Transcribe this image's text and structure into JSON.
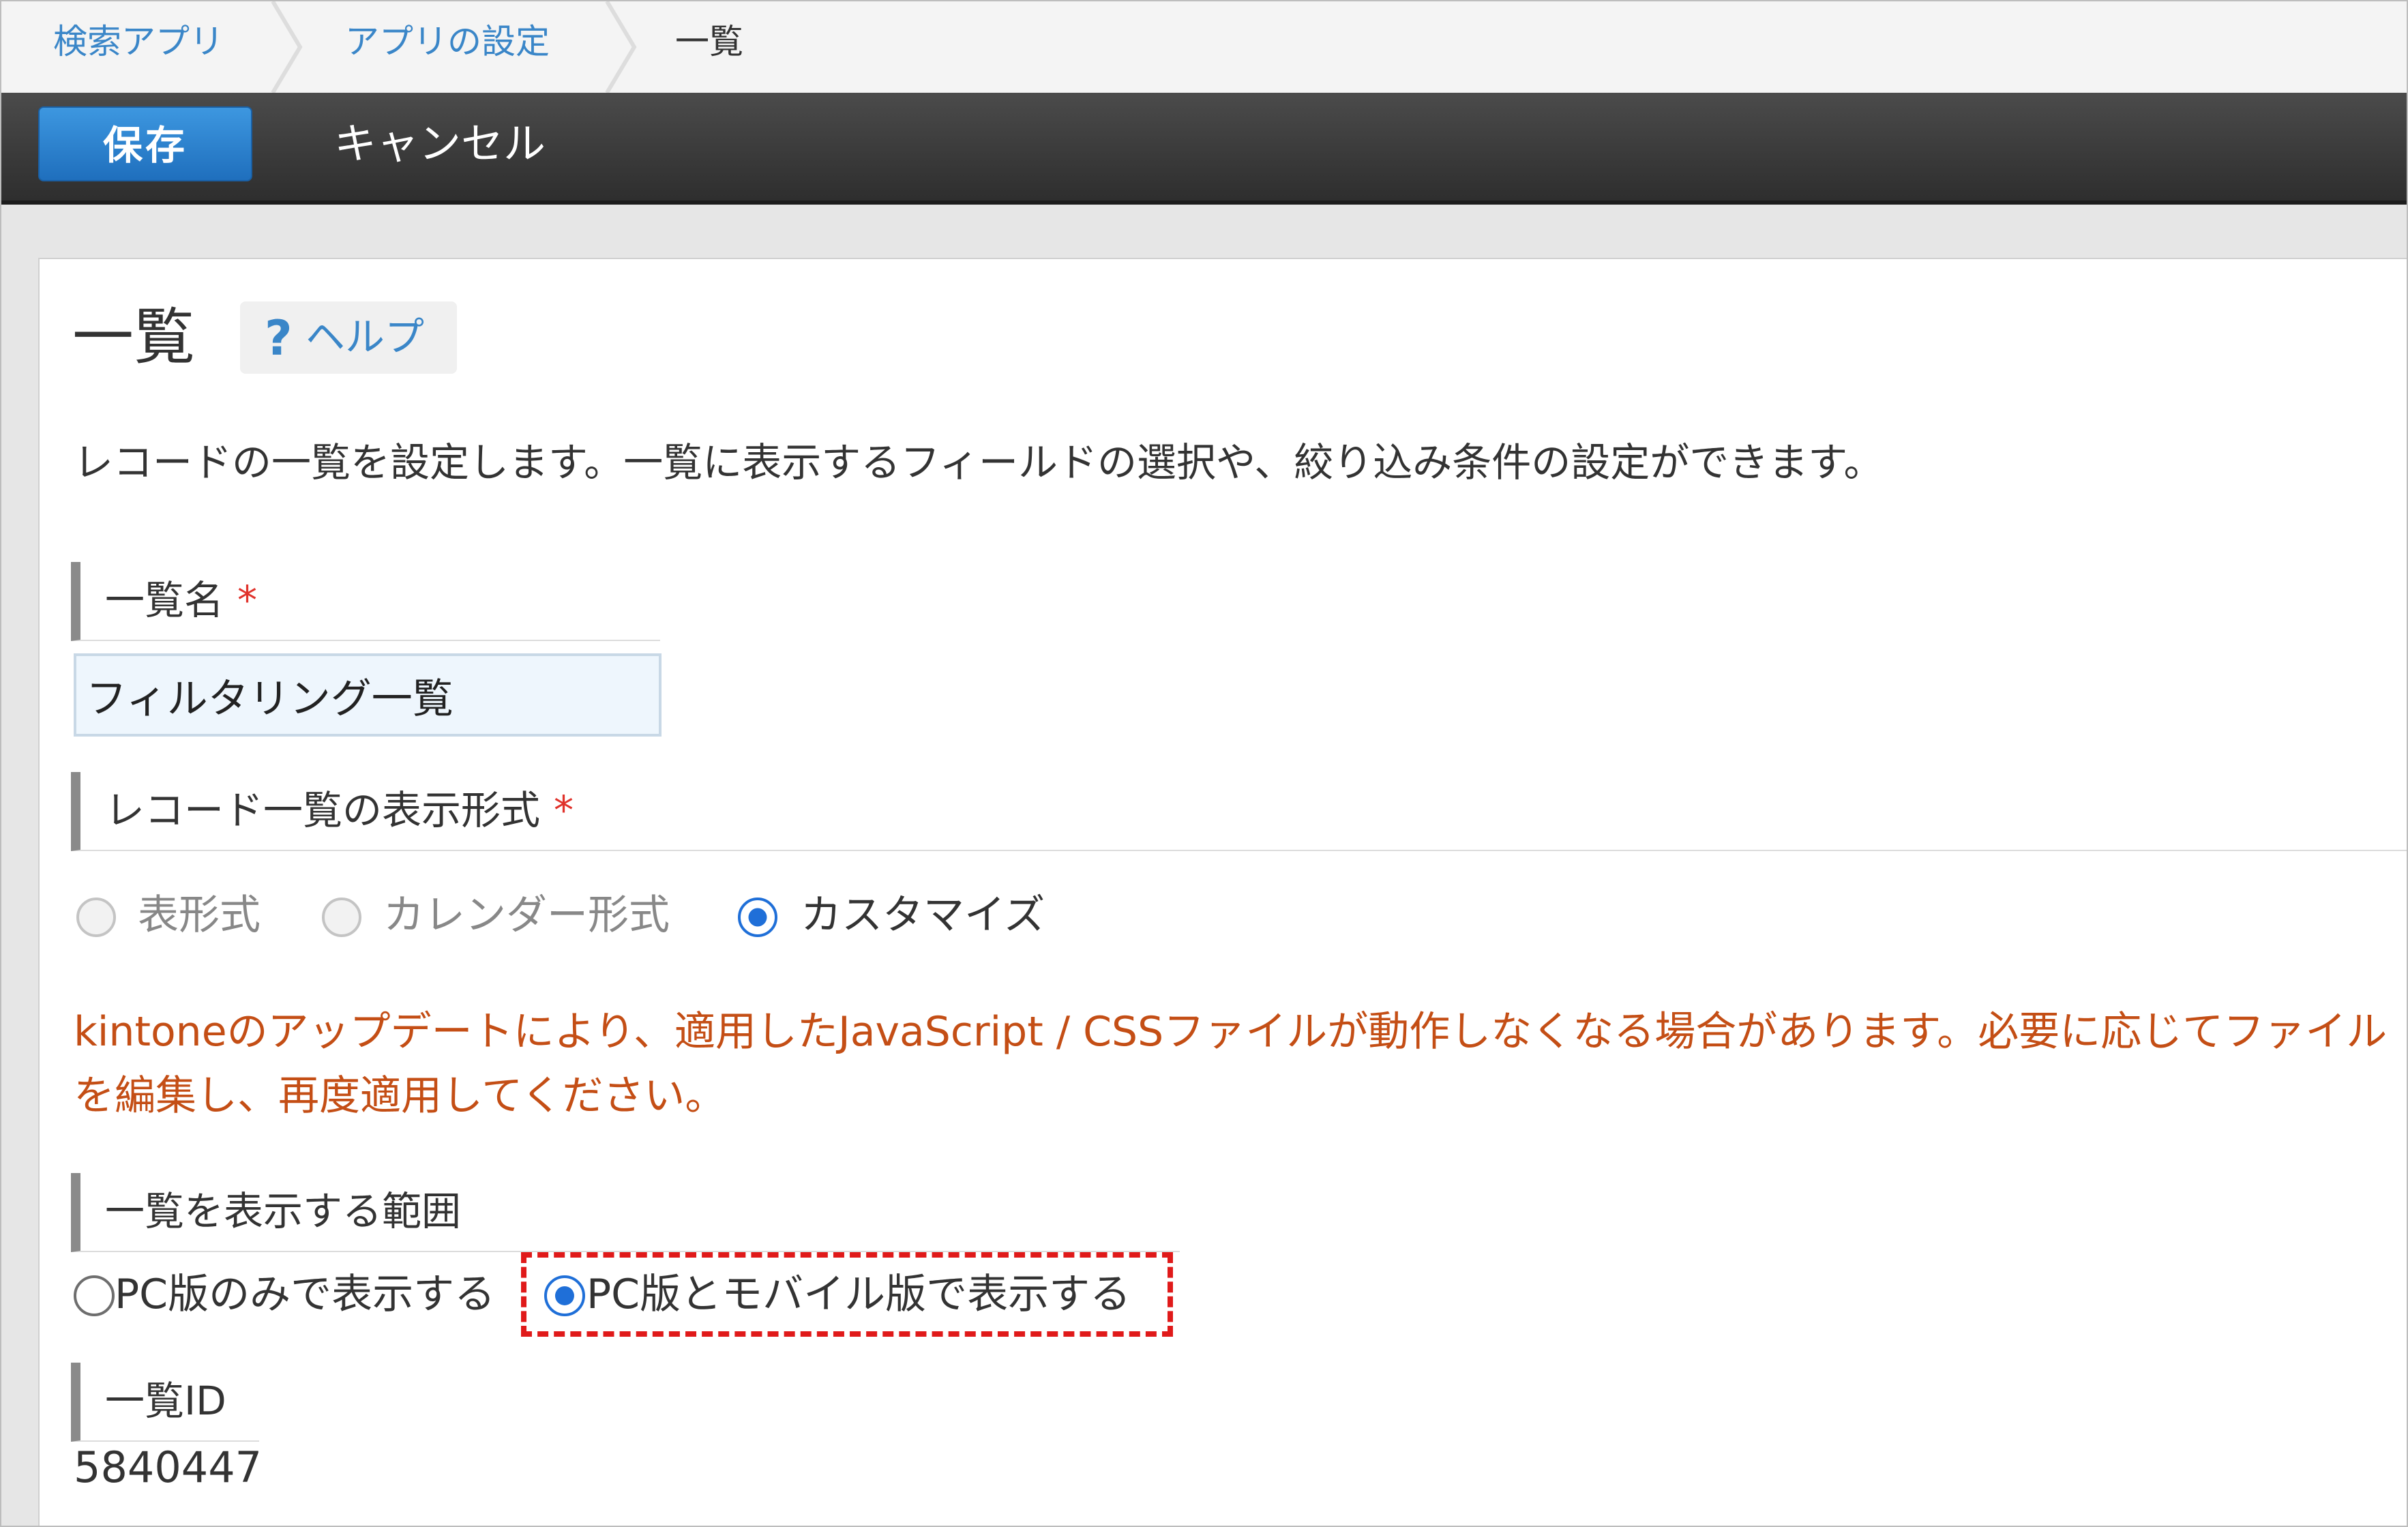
{
  "breadcrumb": {
    "items": [
      {
        "label": "検索アプリ"
      },
      {
        "label": "アプリの設定"
      },
      {
        "label": "一覧"
      }
    ]
  },
  "toolbar": {
    "save_label": "保存",
    "cancel_label": "キャンセル"
  },
  "panel": {
    "title": "一覧",
    "help_label": "ヘルプ",
    "help_icon": "?",
    "description": "レコードの一覧を設定します。一覧に表示するフィールドの選択や、絞り込み条件の設定ができます。"
  },
  "list_name": {
    "heading": "一覧名",
    "required_mark": "*",
    "value": "フィルタリング一覧"
  },
  "display_format": {
    "heading": "レコード一覧の表示形式",
    "required_mark": "*",
    "options": [
      {
        "label": "表形式",
        "selected": false,
        "enabled": false
      },
      {
        "label": "カレンダー形式",
        "selected": false,
        "enabled": false
      },
      {
        "label": "カスタマイズ",
        "selected": true,
        "enabled": true
      }
    ]
  },
  "warning": {
    "text": "kintoneのアップデートにより、適用したJavaScript / CSSファイルが動作しなくなる場合があります。必要に応じてファイルを編集し、再度適用してください。"
  },
  "display_scope": {
    "heading": "一覧を表示する範囲",
    "options": [
      {
        "label": "PC版のみで表示する",
        "selected": false
      },
      {
        "label": "PC版とモバイル版で表示する",
        "selected": true
      }
    ]
  },
  "list_id": {
    "heading": "一覧ID",
    "value": "5840447"
  },
  "colors": {
    "accent": "#1f6fd8",
    "link": "#3a86c8",
    "warning": "#c44e15",
    "required": "#e0322b",
    "highlight": "#e01a1a"
  }
}
